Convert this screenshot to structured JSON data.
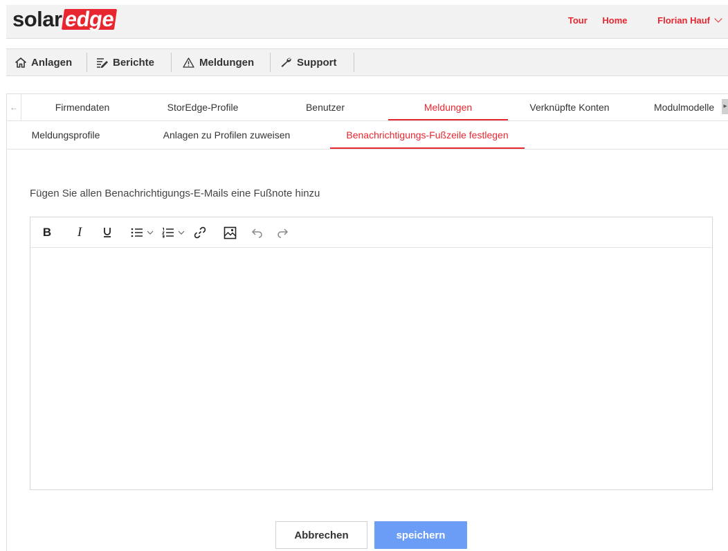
{
  "brand": {
    "part1": "solar",
    "part2": "edge"
  },
  "top_links": {
    "tour": "Tour",
    "home": "Home",
    "user": "Florian Hauf"
  },
  "main_nav": [
    {
      "label": "Anlagen",
      "icon": "home-icon"
    },
    {
      "label": "Berichte",
      "icon": "report-icon"
    },
    {
      "label": "Meldungen",
      "icon": "warning-icon"
    },
    {
      "label": "Support",
      "icon": "wrench-icon"
    }
  ],
  "tabs": [
    {
      "label": "Firmendaten"
    },
    {
      "label": "StorEdge-Profile"
    },
    {
      "label": "Benutzer"
    },
    {
      "label": "Meldungen",
      "active": true
    },
    {
      "label": "Verknüpfte Konten"
    },
    {
      "label": "Modulmodelle"
    }
  ],
  "subtabs": [
    {
      "label": "Meldungsprofile"
    },
    {
      "label": "Anlagen zu Profilen zuweisen"
    },
    {
      "label": "Benachrichtigungs-Fußzeile festlegen",
      "active": true
    }
  ],
  "form": {
    "label": "Fügen Sie allen Benachrichtigungs-E-Mails eine Fußnote hinzu",
    "editor_content": ""
  },
  "toolbar_icons": [
    "bold-icon",
    "italic-icon",
    "underline-icon",
    "bullet-list-icon",
    "numbered-list-icon",
    "link-icon",
    "image-icon",
    "undo-icon",
    "redo-icon"
  ],
  "buttons": {
    "cancel": "Abbrechen",
    "save": "speichern"
  },
  "colors": {
    "accent": "#e8262f",
    "primary_button": "#6b9cf6",
    "header_bg": "#f2f2f2"
  }
}
